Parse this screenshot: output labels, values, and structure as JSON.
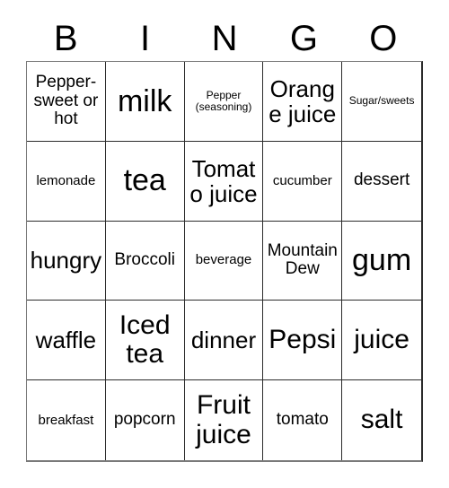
{
  "card": {
    "header": {
      "letters": [
        "B",
        "I",
        "N",
        "G",
        "O"
      ]
    },
    "grid": {
      "columns": 5,
      "rows": 5,
      "cells": [
        {
          "text": "Pepper-sweet or hot",
          "size": "md"
        },
        {
          "text": "milk",
          "size": "xxxl"
        },
        {
          "text": "Pepper (seasoning)",
          "size": "xs"
        },
        {
          "text": "Orange juice",
          "size": "xl"
        },
        {
          "text": "Sugar/sweets",
          "size": "xs"
        },
        {
          "text": "lemonade",
          "size": "sm"
        },
        {
          "text": "tea",
          "size": "xxxl"
        },
        {
          "text": "Tomato juice",
          "size": "xl"
        },
        {
          "text": "cucumber",
          "size": "sm"
        },
        {
          "text": "dessert",
          "size": "md"
        },
        {
          "text": "hungry",
          "size": "xl"
        },
        {
          "text": "Broccoli",
          "size": "md"
        },
        {
          "text": "beverage",
          "size": "sm"
        },
        {
          "text": "Mountain Dew",
          "size": "md"
        },
        {
          "text": "gum",
          "size": "xxxl"
        },
        {
          "text": "waffle",
          "size": "xl"
        },
        {
          "text": "Iced tea",
          "size": "xxl"
        },
        {
          "text": "dinner",
          "size": "xl"
        },
        {
          "text": "Pepsi",
          "size": "xxl"
        },
        {
          "text": "juice",
          "size": "xxl"
        },
        {
          "text": "breakfast",
          "size": "sm"
        },
        {
          "text": "popcorn",
          "size": "md"
        },
        {
          "text": "Fruit juice",
          "size": "xxl"
        },
        {
          "text": "tomato",
          "size": "md"
        },
        {
          "text": "salt",
          "size": "xxl"
        }
      ]
    },
    "colors": {
      "background": "#ffffff",
      "text": "#000000",
      "grid_line": "#2b2b2b",
      "grid_outer": "#7a7a7a"
    }
  }
}
